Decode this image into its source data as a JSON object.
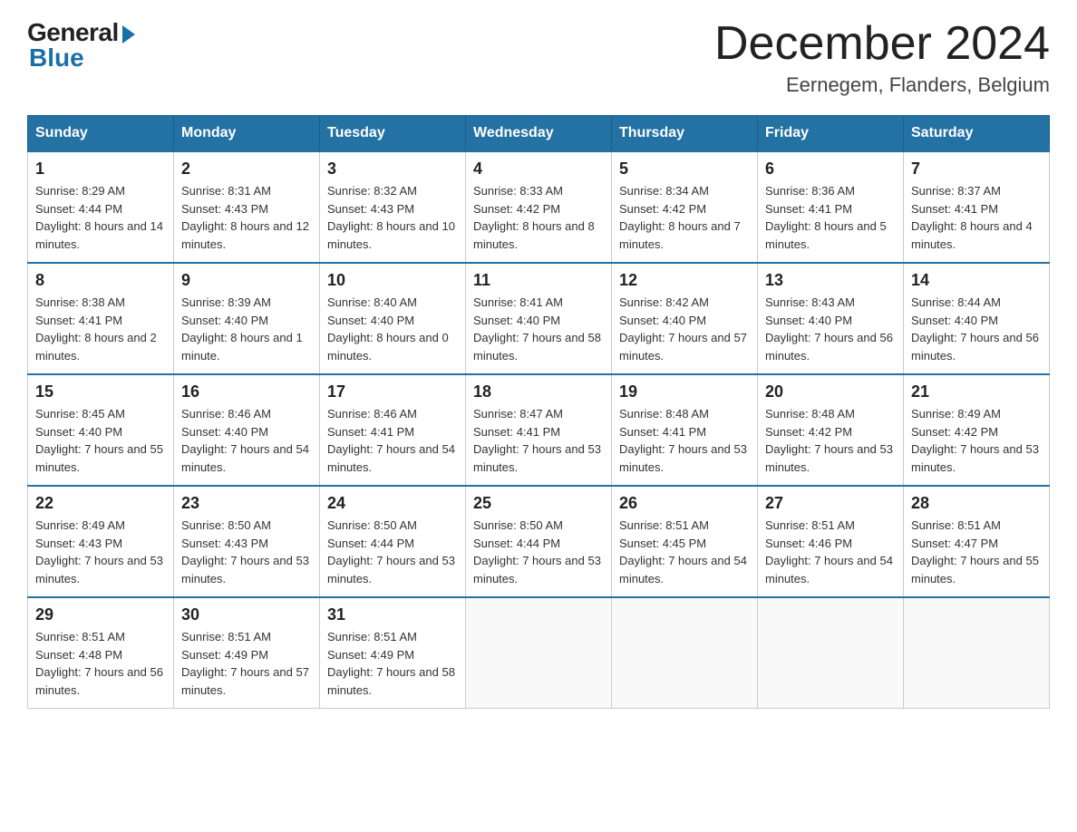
{
  "header": {
    "logo_general": "General",
    "logo_blue": "Blue",
    "title": "December 2024",
    "location": "Eernegem, Flanders, Belgium"
  },
  "days_of_week": [
    "Sunday",
    "Monday",
    "Tuesday",
    "Wednesday",
    "Thursday",
    "Friday",
    "Saturday"
  ],
  "weeks": [
    [
      {
        "day": "1",
        "sunrise": "8:29 AM",
        "sunset": "4:44 PM",
        "daylight": "8 hours and 14 minutes."
      },
      {
        "day": "2",
        "sunrise": "8:31 AM",
        "sunset": "4:43 PM",
        "daylight": "8 hours and 12 minutes."
      },
      {
        "day": "3",
        "sunrise": "8:32 AM",
        "sunset": "4:43 PM",
        "daylight": "8 hours and 10 minutes."
      },
      {
        "day": "4",
        "sunrise": "8:33 AM",
        "sunset": "4:42 PM",
        "daylight": "8 hours and 8 minutes."
      },
      {
        "day": "5",
        "sunrise": "8:34 AM",
        "sunset": "4:42 PM",
        "daylight": "8 hours and 7 minutes."
      },
      {
        "day": "6",
        "sunrise": "8:36 AM",
        "sunset": "4:41 PM",
        "daylight": "8 hours and 5 minutes."
      },
      {
        "day": "7",
        "sunrise": "8:37 AM",
        "sunset": "4:41 PM",
        "daylight": "8 hours and 4 minutes."
      }
    ],
    [
      {
        "day": "8",
        "sunrise": "8:38 AM",
        "sunset": "4:41 PM",
        "daylight": "8 hours and 2 minutes."
      },
      {
        "day": "9",
        "sunrise": "8:39 AM",
        "sunset": "4:40 PM",
        "daylight": "8 hours and 1 minute."
      },
      {
        "day": "10",
        "sunrise": "8:40 AM",
        "sunset": "4:40 PM",
        "daylight": "8 hours and 0 minutes."
      },
      {
        "day": "11",
        "sunrise": "8:41 AM",
        "sunset": "4:40 PM",
        "daylight": "7 hours and 58 minutes."
      },
      {
        "day": "12",
        "sunrise": "8:42 AM",
        "sunset": "4:40 PM",
        "daylight": "7 hours and 57 minutes."
      },
      {
        "day": "13",
        "sunrise": "8:43 AM",
        "sunset": "4:40 PM",
        "daylight": "7 hours and 56 minutes."
      },
      {
        "day": "14",
        "sunrise": "8:44 AM",
        "sunset": "4:40 PM",
        "daylight": "7 hours and 56 minutes."
      }
    ],
    [
      {
        "day": "15",
        "sunrise": "8:45 AM",
        "sunset": "4:40 PM",
        "daylight": "7 hours and 55 minutes."
      },
      {
        "day": "16",
        "sunrise": "8:46 AM",
        "sunset": "4:40 PM",
        "daylight": "7 hours and 54 minutes."
      },
      {
        "day": "17",
        "sunrise": "8:46 AM",
        "sunset": "4:41 PM",
        "daylight": "7 hours and 54 minutes."
      },
      {
        "day": "18",
        "sunrise": "8:47 AM",
        "sunset": "4:41 PM",
        "daylight": "7 hours and 53 minutes."
      },
      {
        "day": "19",
        "sunrise": "8:48 AM",
        "sunset": "4:41 PM",
        "daylight": "7 hours and 53 minutes."
      },
      {
        "day": "20",
        "sunrise": "8:48 AM",
        "sunset": "4:42 PM",
        "daylight": "7 hours and 53 minutes."
      },
      {
        "day": "21",
        "sunrise": "8:49 AM",
        "sunset": "4:42 PM",
        "daylight": "7 hours and 53 minutes."
      }
    ],
    [
      {
        "day": "22",
        "sunrise": "8:49 AM",
        "sunset": "4:43 PM",
        "daylight": "7 hours and 53 minutes."
      },
      {
        "day": "23",
        "sunrise": "8:50 AM",
        "sunset": "4:43 PM",
        "daylight": "7 hours and 53 minutes."
      },
      {
        "day": "24",
        "sunrise": "8:50 AM",
        "sunset": "4:44 PM",
        "daylight": "7 hours and 53 minutes."
      },
      {
        "day": "25",
        "sunrise": "8:50 AM",
        "sunset": "4:44 PM",
        "daylight": "7 hours and 53 minutes."
      },
      {
        "day": "26",
        "sunrise": "8:51 AM",
        "sunset": "4:45 PM",
        "daylight": "7 hours and 54 minutes."
      },
      {
        "day": "27",
        "sunrise": "8:51 AM",
        "sunset": "4:46 PM",
        "daylight": "7 hours and 54 minutes."
      },
      {
        "day": "28",
        "sunrise": "8:51 AM",
        "sunset": "4:47 PM",
        "daylight": "7 hours and 55 minutes."
      }
    ],
    [
      {
        "day": "29",
        "sunrise": "8:51 AM",
        "sunset": "4:48 PM",
        "daylight": "7 hours and 56 minutes."
      },
      {
        "day": "30",
        "sunrise": "8:51 AM",
        "sunset": "4:49 PM",
        "daylight": "7 hours and 57 minutes."
      },
      {
        "day": "31",
        "sunrise": "8:51 AM",
        "sunset": "4:49 PM",
        "daylight": "7 hours and 58 minutes."
      },
      null,
      null,
      null,
      null
    ]
  ],
  "labels": {
    "sunrise": "Sunrise:",
    "sunset": "Sunset:",
    "daylight": "Daylight:"
  }
}
